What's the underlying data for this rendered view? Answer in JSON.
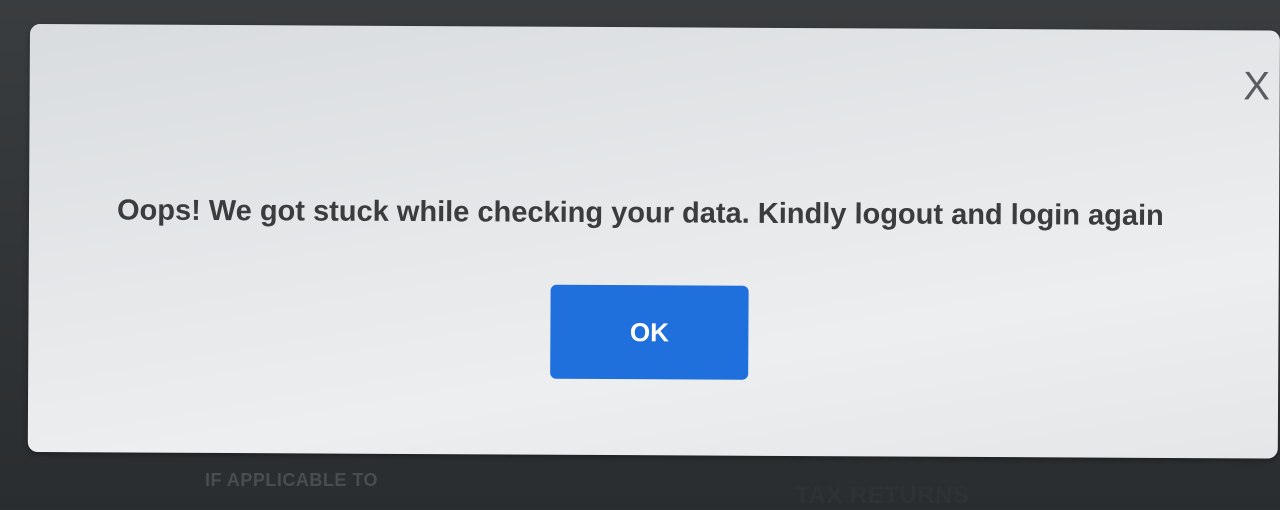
{
  "background": {
    "left_text": "IF APPLICABLE TO",
    "right_text": "TAX RETURNS"
  },
  "dialog": {
    "close_label": "X",
    "message": "Oops! We got stuck while checking your data. Kindly logout and login again",
    "ok_label": "OK"
  },
  "colors": {
    "button": "#1f6fdc",
    "dialog_bg": "#e6e8ea",
    "text": "#3a3c3e"
  }
}
